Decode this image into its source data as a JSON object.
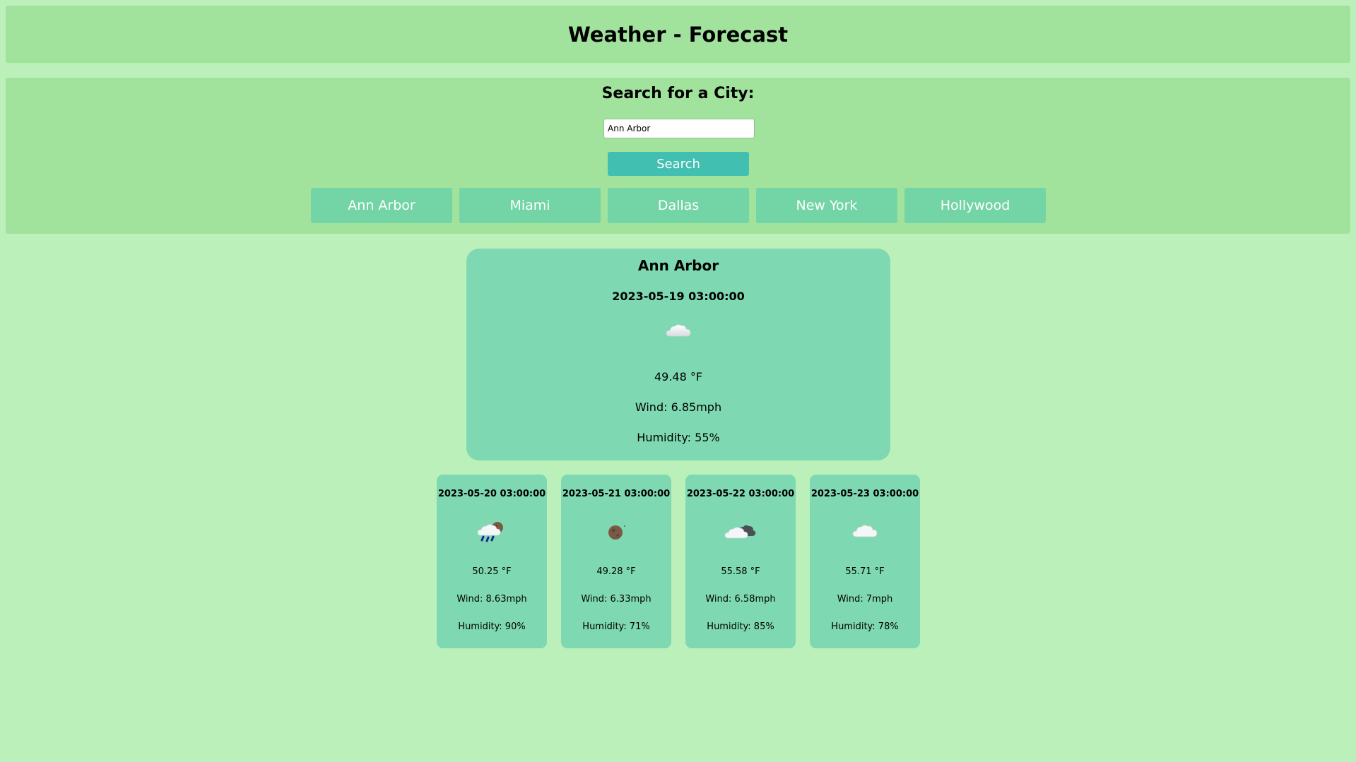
{
  "header": {
    "title": "Weather - Forecast"
  },
  "search": {
    "title": "Search for a City:",
    "input_value": "Ann Arbor",
    "button_label": "Search"
  },
  "cities": [
    "Ann Arbor",
    "Miami",
    "Dallas",
    "New York",
    "Hollywood"
  ],
  "current": {
    "city": "Ann Arbor",
    "date": "2023-05-19 03:00:00",
    "icon": "cloud-icon",
    "temp": "49.48 °F",
    "wind": "Wind: 6.85mph",
    "humidity": "Humidity: 55%"
  },
  "forecast": [
    {
      "date": "2023-05-20 03:00:00",
      "icon": "rain-cloud-night-icon",
      "temp": "50.25 °F",
      "wind": "Wind: 8.63mph",
      "humidity": "Humidity: 90%"
    },
    {
      "date": "2023-05-21 03:00:00",
      "icon": "moon-icon",
      "temp": "49.28 °F",
      "wind": "Wind: 6.33mph",
      "humidity": "Humidity: 71%"
    },
    {
      "date": "2023-05-22 03:00:00",
      "icon": "cloud-dark-cloud-icon",
      "temp": "55.58 °F",
      "wind": "Wind: 6.58mph",
      "humidity": "Humidity: 85%"
    },
    {
      "date": "2023-05-23 03:00:00",
      "icon": "cloud-icon",
      "temp": "55.71 °F",
      "wind": "Wind: 7mph",
      "humidity": "Humidity: 78%"
    }
  ],
  "colors": {
    "page_bg": "#bbf0bb",
    "panel_bg": "#a1e39c",
    "search_button": "#41bfb0",
    "city_button": "#73d4a6",
    "card_bg": "#7ed8b1"
  }
}
